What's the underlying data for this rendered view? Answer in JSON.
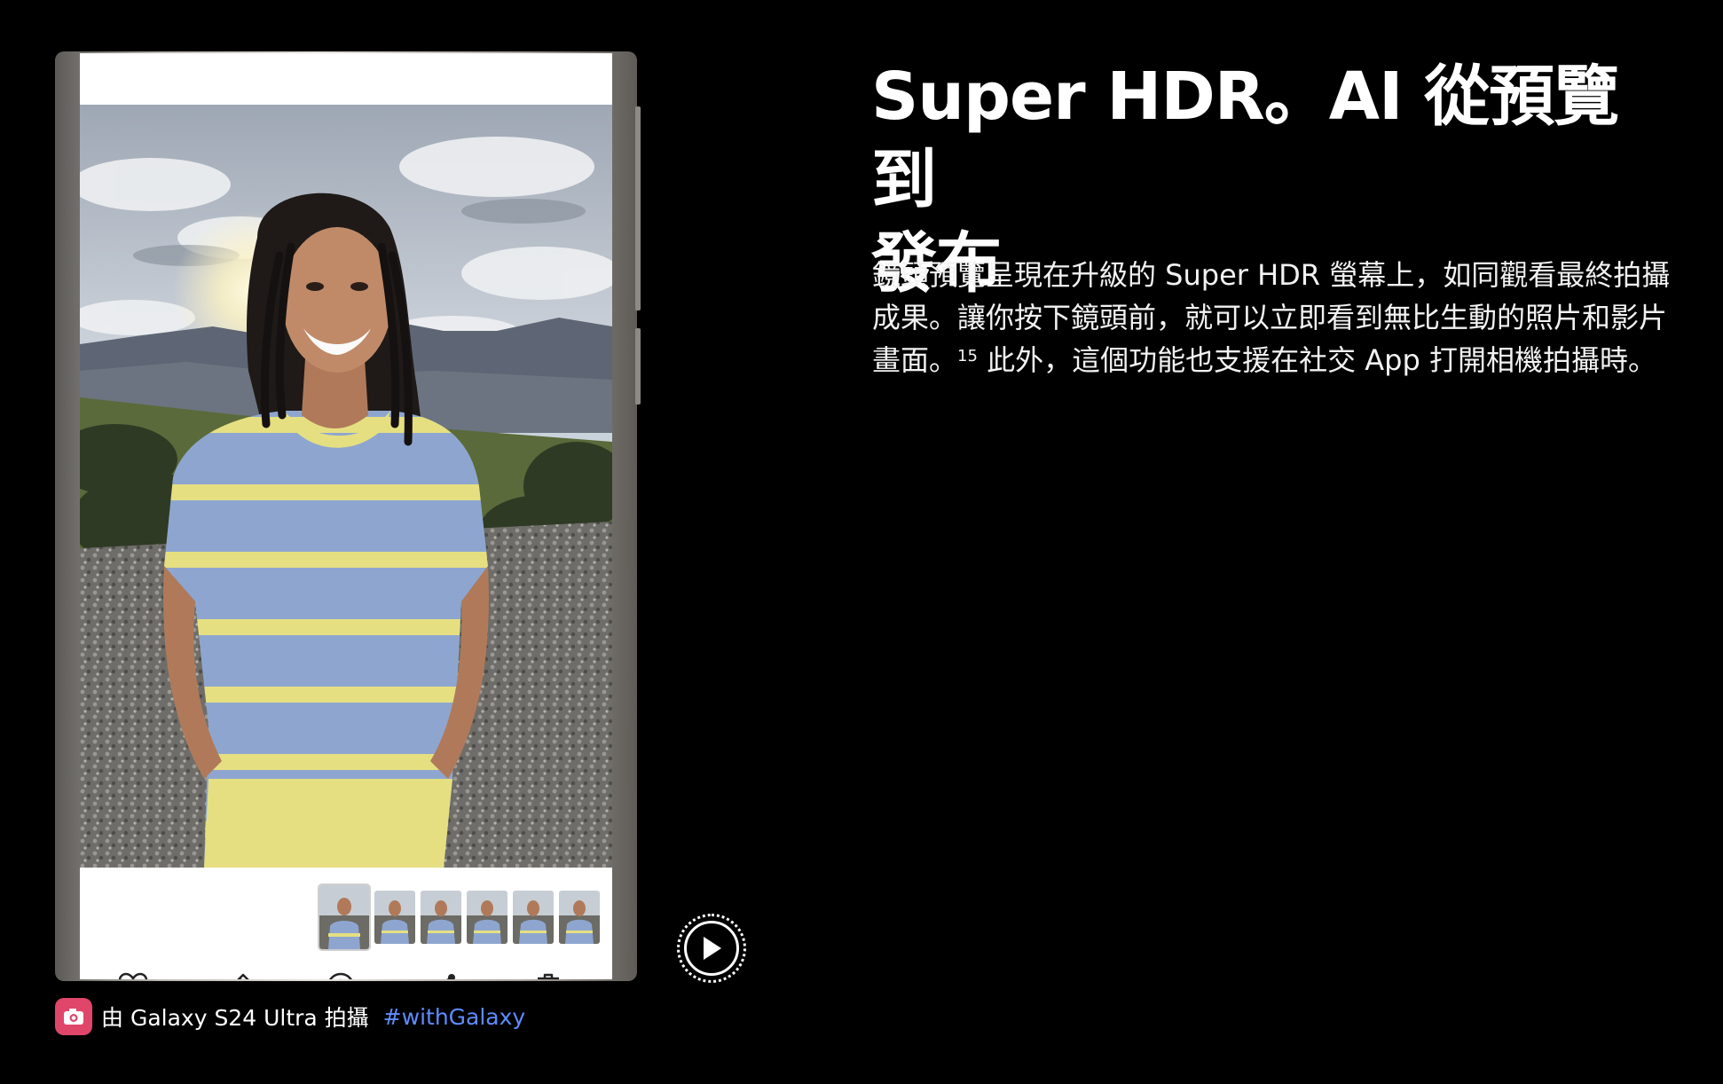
{
  "headline": {
    "line1": "Super HDR。AI 從預覽到",
    "line2": "發布"
  },
  "body": {
    "text_before_sup": "鏡頭預覽呈現在升級的 Super HDR 螢幕上，如同觀看最終拍攝成果。讓你按下鏡頭前，就可以立即看到無比生動的照片和影片畫面。",
    "footnote": "15",
    "text_after_sup": " 此外，這個功能也支援在社交 App 打開相機拍攝時。"
  },
  "caption": {
    "text": "由 Galaxy S24 Ultra 拍攝",
    "hashtag": "#withGalaxy",
    "icon": "camera-icon"
  },
  "phone": {
    "gallery_actions": [
      "heart-icon",
      "pencil-icon",
      "info-icon",
      "share-icon",
      "trash-icon"
    ],
    "thumbnail_count": 6,
    "selected_thumbnail": 1
  },
  "video_control": {
    "icon": "play-icon"
  },
  "colors": {
    "background": "#000000",
    "hashtag": "#5e8cff",
    "camera_badge": "#e0466a",
    "sweater_blue": "#8ea6cf",
    "sweater_yellow": "#e6df82"
  }
}
